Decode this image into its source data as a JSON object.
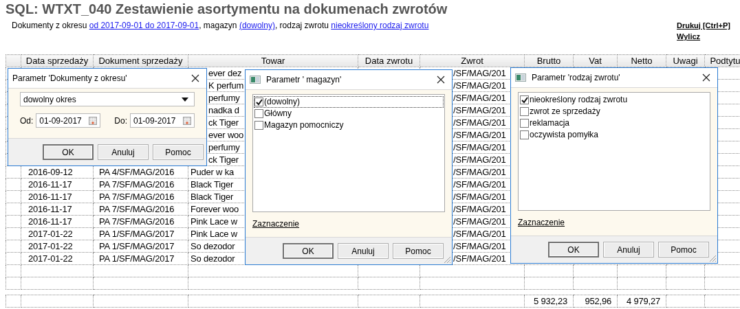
{
  "report": {
    "title": "SQL: WTXT_040 Zestawienie asortymentu na dokumenach zwrotów",
    "filter_line": [
      {
        "kind": "text",
        "text": "Dokumenty z okresu "
      },
      {
        "kind": "link",
        "text": "od 2017-09-01 do 2017-09-01"
      },
      {
        "kind": "text",
        "text": ", magazyn "
      },
      {
        "kind": "link",
        "text": "(dowolny)"
      },
      {
        "kind": "text",
        "text": ", rodzaj zwrotu "
      },
      {
        "kind": "link",
        "text": "nieokreślony rodzaj zwrotu"
      }
    ],
    "actions": [
      "Drukuj [Ctrl+P]",
      "Wylicz"
    ]
  },
  "table": {
    "columns": [
      "Data sprzedaży",
      "Dokument sprzedaży",
      "Towar",
      "Data zwrotu",
      "Zwrot",
      "Brutto",
      "Vat",
      "Netto",
      "Uwagi",
      "Podtytu"
    ],
    "rows": [
      {
        "towar": "ever dez",
        "zwrot": "/SF/MAG/201"
      },
      {
        "towar": "K perfum",
        "zwrot": "/SF/MAG/201"
      },
      {
        "towar": "perfumy",
        "zwrot": "/SF/MAG/201"
      },
      {
        "towar": "nadka d",
        "zwrot": "/SF/MAG/201"
      },
      {
        "towar": "ck Tiger",
        "zwrot": "/SF/MAG/201"
      },
      {
        "towar": "ever woo",
        "zwrot": "/SF/MAG/201"
      },
      {
        "towar": "perfumy",
        "zwrot": "/SF/MAG/201"
      },
      {
        "towar": "ck Tiger",
        "zwrot": "/SF/MAG/201"
      },
      {
        "data_sprzedazy": "2016-09-12",
        "dokument_sprzedazy": "PA 4/SF/MAG/2016",
        "towar": "Puder w ka",
        "zwrot": "/SF/MAG/201"
      },
      {
        "data_sprzedazy": "2016-11-17",
        "dokument_sprzedazy": "PA 7/SF/MAG/2016",
        "towar": "Black Tiger",
        "zwrot": "/SF/MAG/201"
      },
      {
        "data_sprzedazy": "2016-11-17",
        "dokument_sprzedazy": "PA 7/SF/MAG/2016",
        "towar": "Black Tiger",
        "zwrot": "/SF/MAG/201"
      },
      {
        "data_sprzedazy": "2016-11-17",
        "dokument_sprzedazy": "PA 7/SF/MAG/2016",
        "towar": "Forever woo",
        "zwrot": "/SF/MAG/201"
      },
      {
        "data_sprzedazy": "2016-11-17",
        "dokument_sprzedazy": "PA 7/SF/MAG/2016",
        "towar": "Pink Lace w",
        "zwrot": "/SF/MAG/201"
      },
      {
        "data_sprzedazy": "2017-01-22",
        "dokument_sprzedazy": "PA 1/SF/MAG/2017",
        "towar": "Pink Lace w",
        "zwrot": "/SF/MAG/201"
      },
      {
        "data_sprzedazy": "2017-01-22",
        "dokument_sprzedazy": "PA 1/SF/MAG/2017",
        "towar": "So dezodor",
        "zwrot": "/SF/MAG/201"
      },
      {
        "data_sprzedazy": "2017-01-22",
        "dokument_sprzedazy": "PA 1/SF/MAG/2017",
        "towar": "So dezodor",
        "zwrot": "/SF/MAG/201"
      }
    ],
    "totals": {
      "brutto": "5 932,23",
      "vat": "952,96",
      "netto": "4 979,27"
    }
  },
  "dialogs": [
    {
      "kind": "period",
      "title": "Parametr 'Dokumenty z okresu'",
      "icon": false,
      "period": "dowolny okres",
      "from_label": "Od:",
      "from": "01-09-2017",
      "to_label": "Do:",
      "to": "01-09-2017",
      "buttons": [
        "OK",
        "Anuluj",
        "Pomoc"
      ]
    },
    {
      "kind": "checklist",
      "title": "Parametr ' magazyn'",
      "icon": true,
      "items": [
        {
          "label": "(dowolny)",
          "checked": true,
          "focused": true
        },
        {
          "label": "Główny",
          "checked": false,
          "focused": false
        },
        {
          "label": "Magazyn pomocniczy",
          "checked": false,
          "focused": false
        }
      ],
      "link": "Zaznaczenie",
      "buttons": [
        "OK",
        "Anuluj",
        "Pomoc"
      ]
    },
    {
      "kind": "checklist",
      "title": "Parametr 'rodzaj zwrotu'",
      "icon": true,
      "items": [
        {
          "label": "nieokreślony rodzaj zwrotu",
          "checked": true,
          "focused": false
        },
        {
          "label": "zwrot ze sprzedaży",
          "checked": false,
          "focused": false
        },
        {
          "label": "reklamacja",
          "checked": false,
          "focused": false
        },
        {
          "label": "oczywista pomyłka",
          "checked": false,
          "focused": false
        }
      ],
      "link": "Zaznaczenie",
      "buttons": [
        "OK",
        "Anuluj",
        "Pomoc"
      ]
    }
  ]
}
